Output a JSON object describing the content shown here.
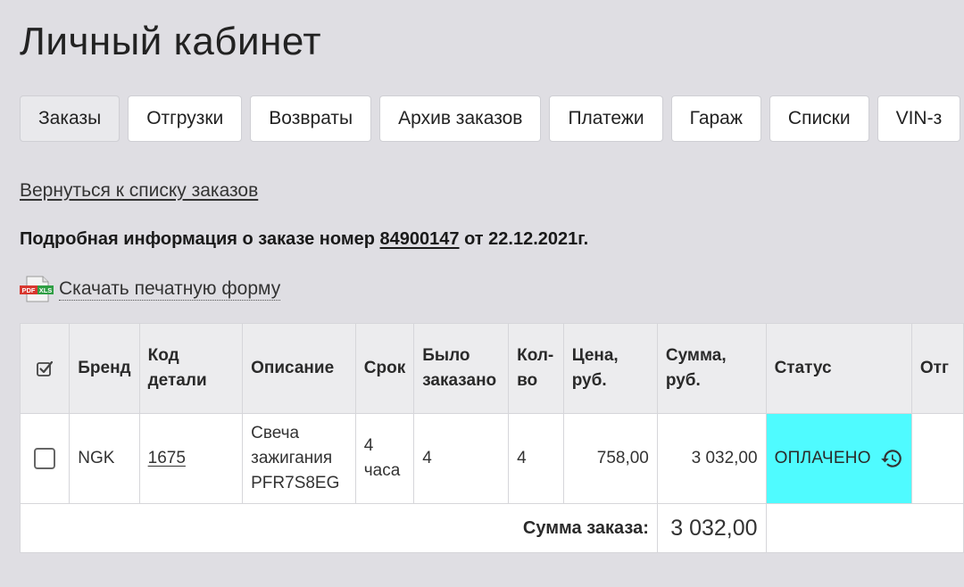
{
  "page": {
    "title": "Личный кабинет"
  },
  "tabs": [
    {
      "label": "Заказы",
      "active": true
    },
    {
      "label": "Отгрузки"
    },
    {
      "label": "Возвраты"
    },
    {
      "label": "Архив заказов"
    },
    {
      "label": "Платежи"
    },
    {
      "label": "Гараж"
    },
    {
      "label": "Списки"
    },
    {
      "label": "VIN-з"
    }
  ],
  "back_link": "Вернуться к списку заказов",
  "order": {
    "prefix": "Подробная информация о заказе номер ",
    "number": "84900147",
    "suffix": " от 22.12.2021г."
  },
  "download": {
    "label": "Скачать печатную форму",
    "icon_pdf": "PDF",
    "icon_xls": "XLS"
  },
  "table": {
    "headers": {
      "brand": "Бренд",
      "code": "Код детали",
      "description": "Описание",
      "term": "Срок",
      "ordered": "Было заказано",
      "qty": "Кол-во",
      "price": "Цена, руб.",
      "sum": "Сумма, руб.",
      "status": "Статус",
      "next": "Отг"
    },
    "rows": [
      {
        "brand": "NGK",
        "code": "1675",
        "description": "Свеча зажигания PFR7S8EG",
        "term": "4 часа",
        "ordered": "4",
        "qty": "4",
        "price": "758,00",
        "sum": "3 032,00",
        "status": "ОПЛАЧЕНО",
        "status_color": "#4ffbff"
      }
    ],
    "total_label": "Сумма заказа:",
    "total_value": "3 032,00"
  }
}
